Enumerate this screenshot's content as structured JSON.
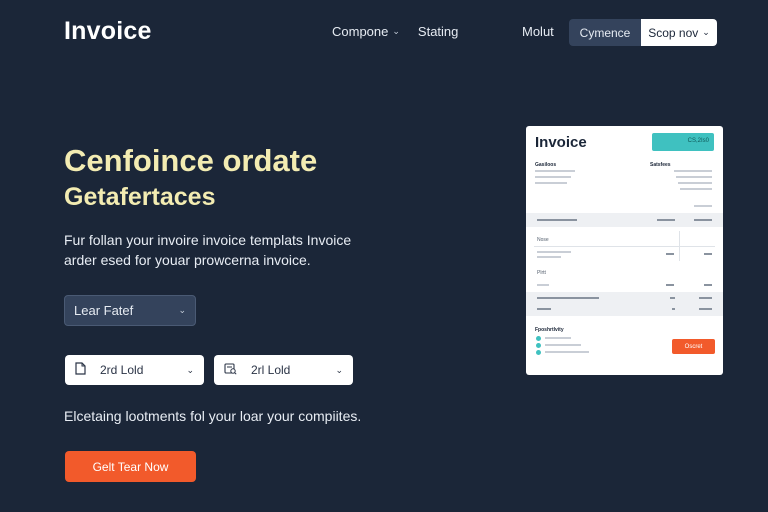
{
  "header": {
    "logo": "Invoice",
    "nav": [
      {
        "label": "Compone",
        "has_dropdown": true
      },
      {
        "label": "Stating",
        "has_dropdown": false
      }
    ],
    "right_link": "Molut",
    "dark_button": "Cymence",
    "light_button": "Scop nov"
  },
  "hero": {
    "title": "Cenfoince ordate",
    "subtitle": "Getafertaces",
    "description": "Fur follan your invoire invoice templats Invoice arder esed for youar prowcerna invoice.",
    "select_value": "Lear Fatef",
    "date_fields": [
      {
        "value": "2rd Lold",
        "icon": "file-icon"
      },
      {
        "value": "2rl Lold",
        "icon": "calendar-search-icon"
      }
    ],
    "tagline": "Elcetaing lootments fol your loar your compiites.",
    "cta": "Gelt Tear Now"
  },
  "preview": {
    "title": "Invoice",
    "badge": "CS,2Is0",
    "from_heading": "Gasiloos",
    "to_heading": "Satsfees",
    "section_a": "Nose",
    "section_b": "Plrtt",
    "footer_heading": "Fposhrtlvity",
    "button": "Oscret"
  },
  "colors": {
    "background": "#1b2638",
    "accent_orange": "#f25a2b",
    "hero_yellow": "#f3ecb2",
    "badge_teal": "#3fc1c0",
    "panel_dark": "#34435c"
  }
}
